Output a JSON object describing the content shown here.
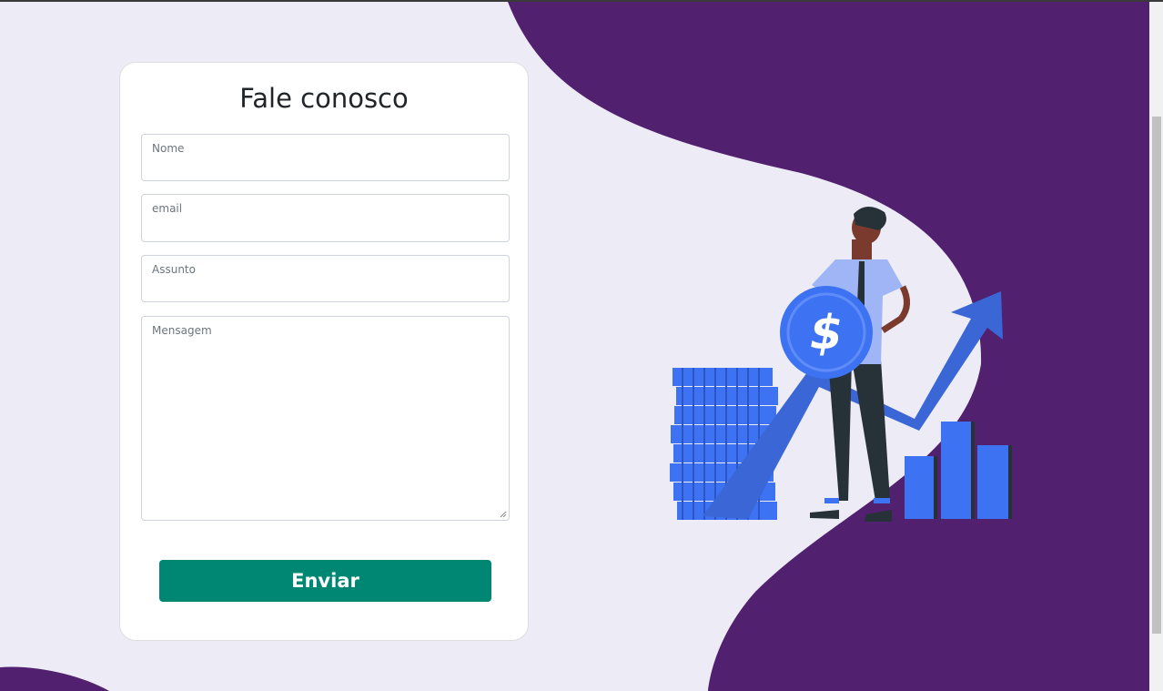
{
  "form": {
    "title": "Fale conosco",
    "fields": [
      {
        "name": "nome",
        "placeholder": "Nome",
        "value": ""
      },
      {
        "name": "email",
        "placeholder": "email",
        "value": ""
      },
      {
        "name": "assunto",
        "placeholder": "Assunto",
        "value": ""
      },
      {
        "name": "mensagem",
        "placeholder": "Mensagem",
        "value": ""
      }
    ],
    "submit_label": "Enviar"
  },
  "colors": {
    "background": "#ecebf6",
    "wave": "#51206f",
    "button": "#008774",
    "illustration_blue": "#3d73f2"
  },
  "illustration": {
    "icon": "finance-growth-illustration",
    "coin_symbol": "$"
  }
}
